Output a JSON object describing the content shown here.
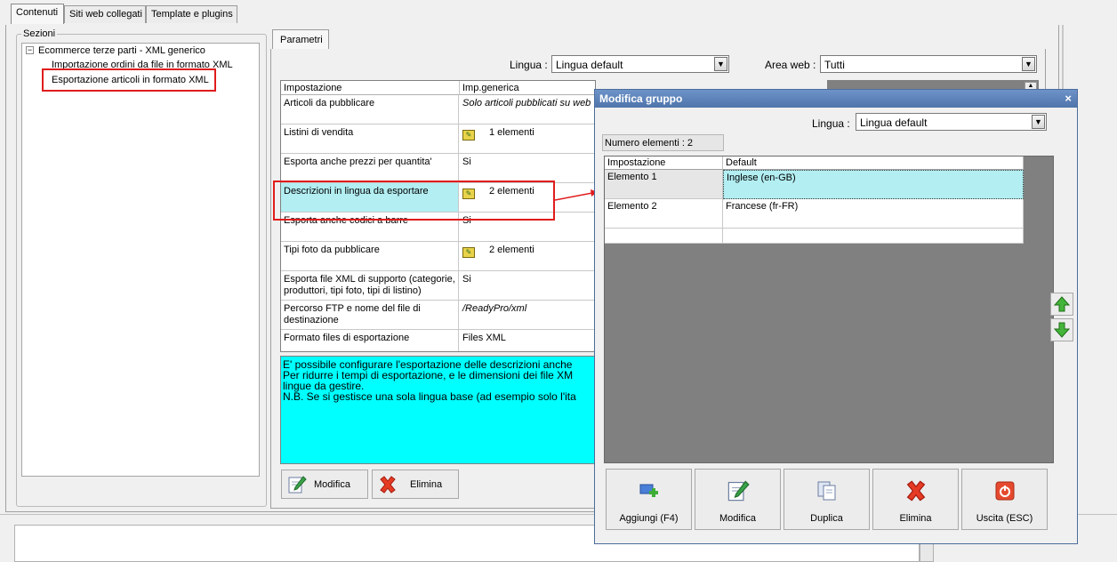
{
  "top_tabs": [
    "Contenuti",
    "Siti web collegati",
    "Template e plugins"
  ],
  "sezioni": {
    "legend": "Sezioni",
    "tree_root": "Ecommerce terze parti - XML generico",
    "tree_items": [
      "Importazione ordini da file in formato XML",
      "Esportazione articoli in formato XML"
    ]
  },
  "parametri": {
    "tab_label": "Parametri",
    "lingua_label": "Lingua :",
    "lingua_value": "Lingua default",
    "area_label": "Area web :",
    "area_value": "Tutti",
    "table_headers": [
      "Impostazione",
      "Imp.generica"
    ],
    "rows": [
      {
        "name": "Articoli da pubblicare",
        "value": "Solo articoli pubblicati su web"
      },
      {
        "name": "Listini di vendita",
        "value": "1 elementi"
      },
      {
        "name": "Esporta anche prezzi per quantita'",
        "value": "Si"
      },
      {
        "name": "Descrizioni in lingua da esportare",
        "value": "2 elementi"
      },
      {
        "name": "Esporta anche codici a barre",
        "value": "Si"
      },
      {
        "name": "Tipi foto da pubblicare",
        "value": "2 elementi"
      },
      {
        "name": "Esporta file XML di supporto (categorie, produttori, tipi foto, tipi di listino)",
        "value": "Si"
      },
      {
        "name": "Percorso FTP e nome del file di destinazione",
        "value": "/ReadyPro/xml"
      },
      {
        "name": "Formato files di esportazione",
        "value": "Files XML"
      }
    ],
    "info_lines": [
      "E' possibile configurare l'esportazione delle descrizioni anche",
      "Per ridurre i tempi di esportazione, e le dimensioni dei file XM",
      "lingue da gestire.",
      "N.B. Se si gestisce una sola lingua base (ad esempio solo l'ita"
    ],
    "btn_modifica": "Modifica",
    "btn_elimina": "Elimina"
  },
  "dialog": {
    "title": "Modifica gruppo",
    "close": "×",
    "lingua_label": "Lingua :",
    "lingua_value": "Lingua default",
    "num_elementi": "Numero elementi : 2",
    "headers": [
      "Impostazione",
      "Default"
    ],
    "rows": [
      {
        "name": "Elemento 1",
        "value": "Inglese (en-GB)"
      },
      {
        "name": "Elemento 2",
        "value": "Francese (fr-FR)"
      }
    ],
    "buttons": {
      "aggiungi": "Aggiungi (F4)",
      "modifica": "Modifica",
      "duplica": "Duplica",
      "elimina": "Elimina",
      "uscita": "Uscita (ESC)"
    }
  },
  "colors": {
    "highlight_cyan": "#00ffff",
    "selected_row": "#b2eef2",
    "annotation_red": "#e01c1c"
  }
}
